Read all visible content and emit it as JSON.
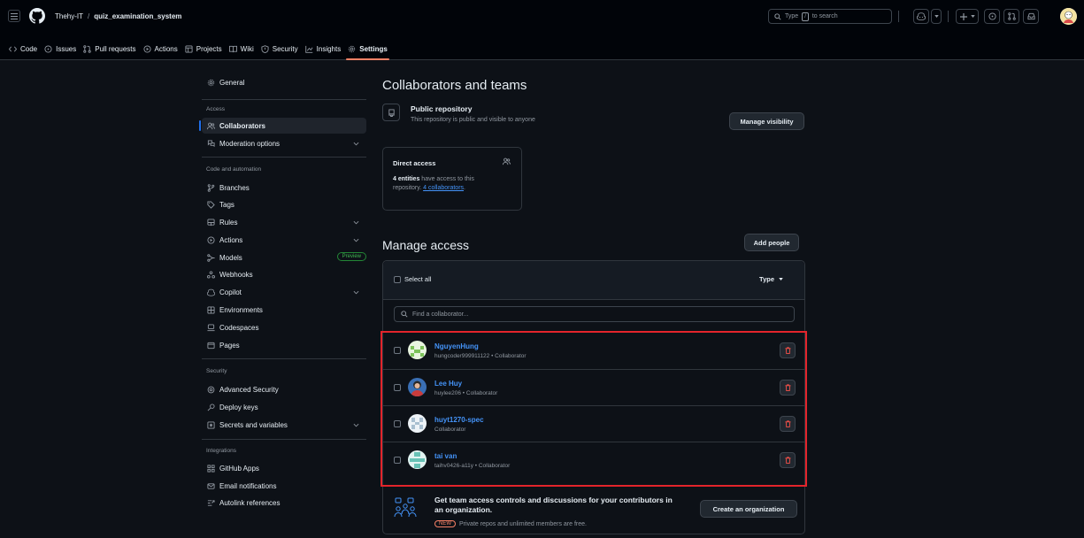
{
  "header": {
    "owner": "Thehy-IT",
    "separator": "/",
    "repo": "quiz_examination_system",
    "search_prefix": "Type",
    "search_key": "/",
    "search_suffix": "to search"
  },
  "tabs": [
    {
      "label": "Code",
      "icon": "code-icon"
    },
    {
      "label": "Issues",
      "icon": "issue-icon"
    },
    {
      "label": "Pull requests",
      "icon": "pull-request-icon"
    },
    {
      "label": "Actions",
      "icon": "play-icon"
    },
    {
      "label": "Projects",
      "icon": "table-icon"
    },
    {
      "label": "Wiki",
      "icon": "book-icon"
    },
    {
      "label": "Security",
      "icon": "shield-icon"
    },
    {
      "label": "Insights",
      "icon": "graph-icon"
    },
    {
      "label": "Settings",
      "icon": "gear-icon",
      "active": true
    }
  ],
  "sidebar": {
    "general": "General",
    "access_heading": "Access",
    "collaborators": "Collaborators",
    "moderation": "Moderation options",
    "code_heading": "Code and automation",
    "branches": "Branches",
    "tags": "Tags",
    "rules": "Rules",
    "actions": "Actions",
    "models": "Models",
    "models_badge": "Preview",
    "webhooks": "Webhooks",
    "copilot": "Copilot",
    "environments": "Environments",
    "codespaces": "Codespaces",
    "pages": "Pages",
    "security_heading": "Security",
    "advanced_security": "Advanced Security",
    "deploy_keys": "Deploy keys",
    "secrets": "Secrets and variables",
    "integrations_heading": "Integrations",
    "github_apps": "GitHub Apps",
    "email_notifications": "Email notifications",
    "autolink": "Autolink references"
  },
  "main": {
    "title": "Collaborators and teams",
    "public_title": "Public repository",
    "public_desc": "This repository is public and visible to anyone",
    "manage_visibility": "Manage visibility",
    "direct_access_title": "Direct access",
    "direct_access_bold": "4 entities",
    "direct_access_text1": " have access to this",
    "direct_access_text2": "repository. ",
    "direct_access_link": "4 collaborators",
    "direct_access_end": ".",
    "manage_access": "Manage access",
    "add_people": "Add people",
    "select_all": "Select all",
    "type_filter": "Type",
    "find_placeholder": "Find a collaborator...",
    "collaborators": [
      {
        "name": "NguyenHung",
        "sub": "hungcoder999911122 • Collaborator"
      },
      {
        "name": "Lee Huy",
        "sub": "huylee206 • Collaborator"
      },
      {
        "name": "huyt1270-spec",
        "sub": "Collaborator"
      },
      {
        "name": "tai van",
        "sub": "taihv0426-a11y • Collaborator"
      }
    ],
    "org_title1": "Get team access controls and discussions for your contributors in",
    "org_title2": "an organization.",
    "org_badge": "NEW",
    "org_desc": "Private repos and unlimited members are free.",
    "create_org": "Create an organization"
  },
  "colors": {
    "accent_link": "#4493f8",
    "danger": "#f85149",
    "highlight_box": "#e3242b",
    "active_tab_underline": "#f78166"
  }
}
